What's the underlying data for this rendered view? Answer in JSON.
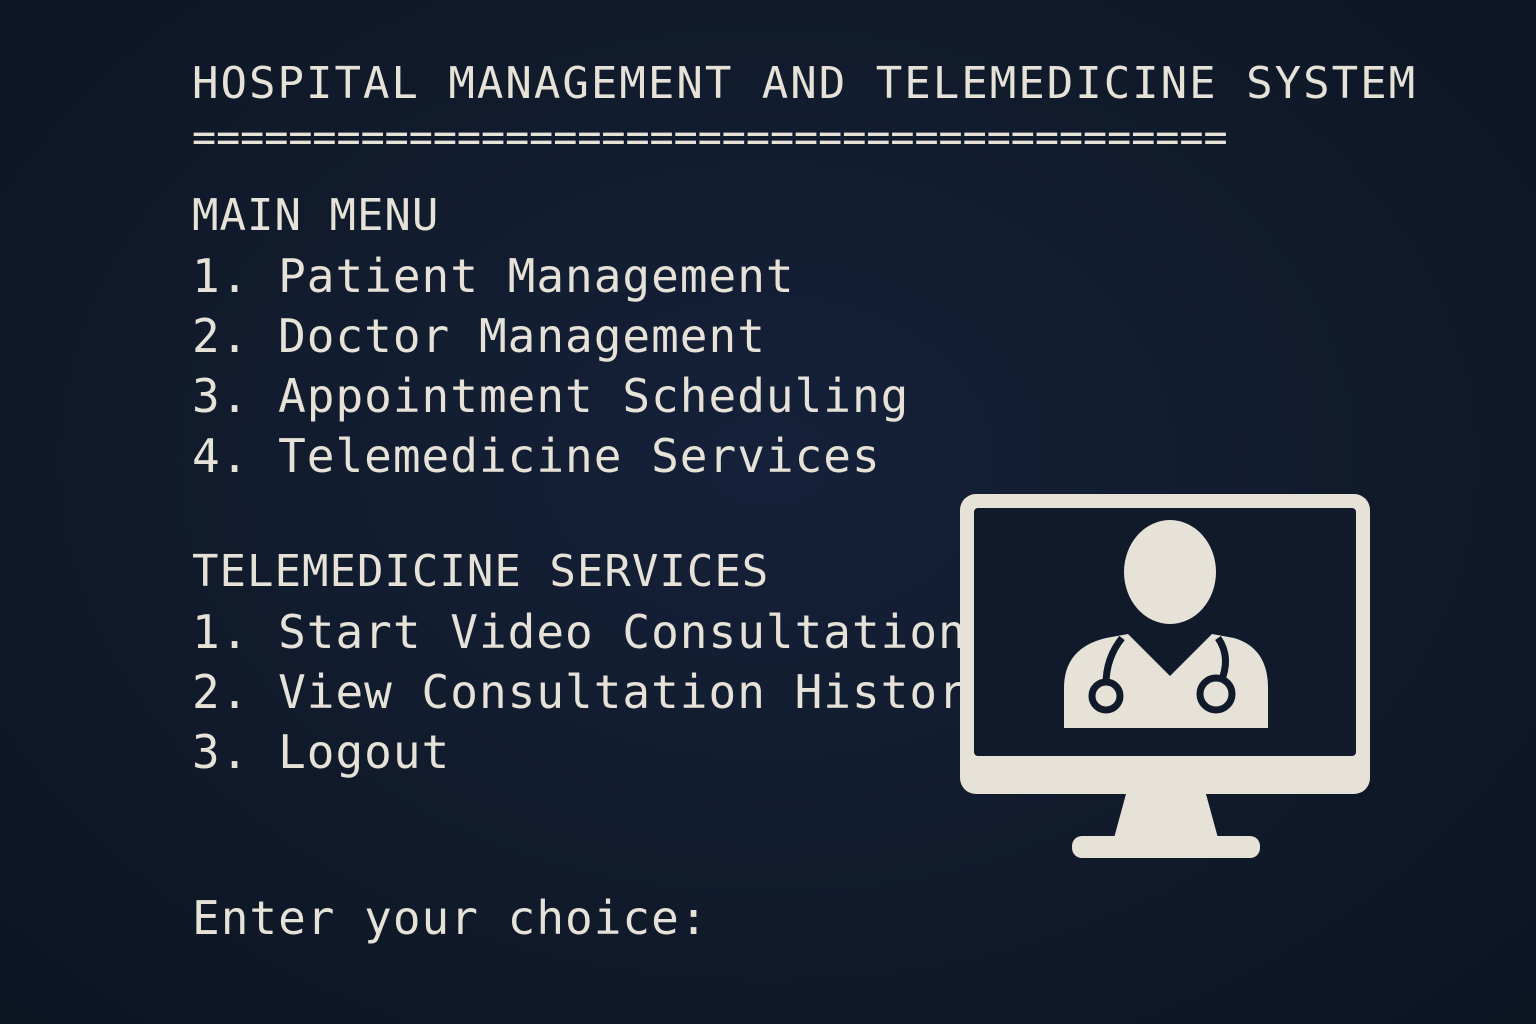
{
  "app": {
    "title": "HOSPITAL MANAGEMENT AND TELEMEDICINE SYSTEM",
    "title_rule": "==========================================="
  },
  "main_menu": {
    "heading": "MAIN MENU",
    "items": [
      {
        "label": "1. Patient Management"
      },
      {
        "label": "2. Doctor Management"
      },
      {
        "label": "3. Appointment Scheduling"
      },
      {
        "label": "4. Telemedicine Services"
      }
    ]
  },
  "telemedicine_menu": {
    "heading": "TELEMEDICINE SERVICES",
    "items": [
      {
        "label": "1. Start Video Consultation"
      },
      {
        "label": "2. View Consultation History"
      },
      {
        "label": "3. Logout"
      }
    ]
  },
  "prompt": {
    "label": "Enter your choice:",
    "value": ""
  },
  "illustration": {
    "icon": "doctor-telemedicine-monitor-icon"
  },
  "colors": {
    "background": "#101a2a",
    "foreground": "#e6e2d8"
  }
}
